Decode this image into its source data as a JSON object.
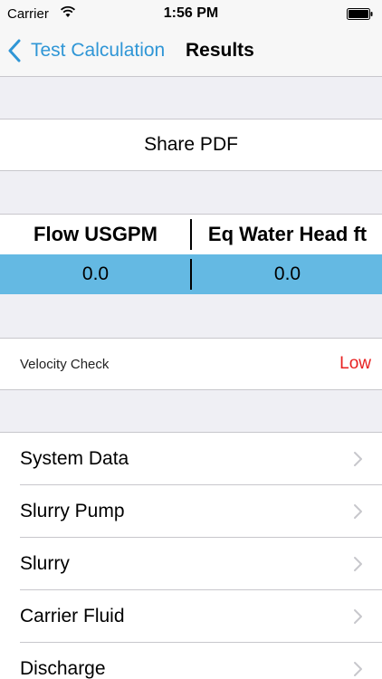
{
  "status_bar": {
    "carrier": "Carrier",
    "time": "1:56 PM"
  },
  "nav": {
    "back_label": "Test Calculation",
    "title": "Results"
  },
  "actions": {
    "share_pdf": "Share PDF"
  },
  "results": {
    "headers": [
      "Flow USGPM",
      "Eq Water Head ft"
    ],
    "values": [
      "0.0",
      "0.0"
    ]
  },
  "velocity_check": {
    "label": "Velocity Check",
    "value": "Low"
  },
  "menu": {
    "items": [
      {
        "label": "System Data"
      },
      {
        "label": "Slurry Pump"
      },
      {
        "label": "Slurry"
      },
      {
        "label": "Carrier Fluid"
      },
      {
        "label": "Discharge"
      }
    ]
  },
  "colors": {
    "accent": "#2f96d6",
    "highlight_row": "#64b9e3",
    "warning": "#e82121",
    "background": "#efeff4"
  }
}
